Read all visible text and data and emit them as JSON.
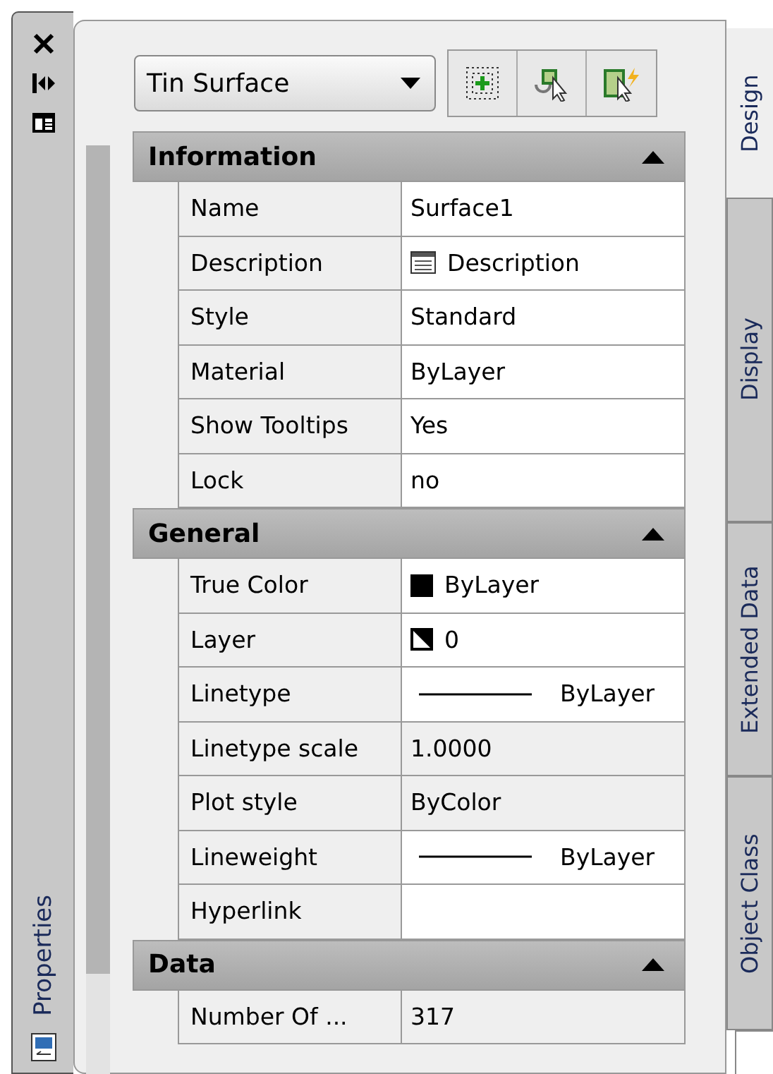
{
  "object_type": {
    "value": "Tin Surface"
  },
  "side_tabs": [
    {
      "label": "Design",
      "selected": true
    },
    {
      "label": "Display",
      "selected": false
    },
    {
      "label": "Extended Data",
      "selected": false
    },
    {
      "label": "Object Class",
      "selected": false
    }
  ],
  "palette_title": "Properties",
  "groups": [
    {
      "title": "Information",
      "expanded": true,
      "rows": [
        {
          "name": "Name",
          "value": "Surface1",
          "kind": "text",
          "readonly": false
        },
        {
          "name": "Description",
          "value": "Description",
          "kind": "description",
          "readonly": false
        },
        {
          "name": "Style",
          "value": "Standard",
          "kind": "text",
          "readonly": false
        },
        {
          "name": "Material",
          "value": "ByLayer",
          "kind": "text",
          "readonly": false
        },
        {
          "name": "Show Tooltips",
          "value": "Yes",
          "kind": "text",
          "readonly": false
        },
        {
          "name": "Lock",
          "value": "no",
          "kind": "text",
          "readonly": false
        }
      ]
    },
    {
      "title": "General",
      "expanded": true,
      "rows": [
        {
          "name": "True Color",
          "value": "ByLayer",
          "kind": "swatch",
          "readonly": false
        },
        {
          "name": "Layer",
          "value": "0",
          "kind": "layer",
          "readonly": false
        },
        {
          "name": "Linetype",
          "value": "ByLayer",
          "kind": "line",
          "readonly": false
        },
        {
          "name": "Linetype scale",
          "value": "1.0000",
          "kind": "text",
          "readonly": true
        },
        {
          "name": "Plot style",
          "value": "ByColor",
          "kind": "text",
          "readonly": true
        },
        {
          "name": "Lineweight",
          "value": "ByLayer",
          "kind": "line",
          "readonly": false
        },
        {
          "name": "Hyperlink",
          "value": "",
          "kind": "text",
          "readonly": false
        }
      ]
    },
    {
      "title": "Data",
      "expanded": true,
      "rows": [
        {
          "name": "Number Of ...",
          "value": "317",
          "kind": "text",
          "readonly": true
        }
      ]
    }
  ]
}
